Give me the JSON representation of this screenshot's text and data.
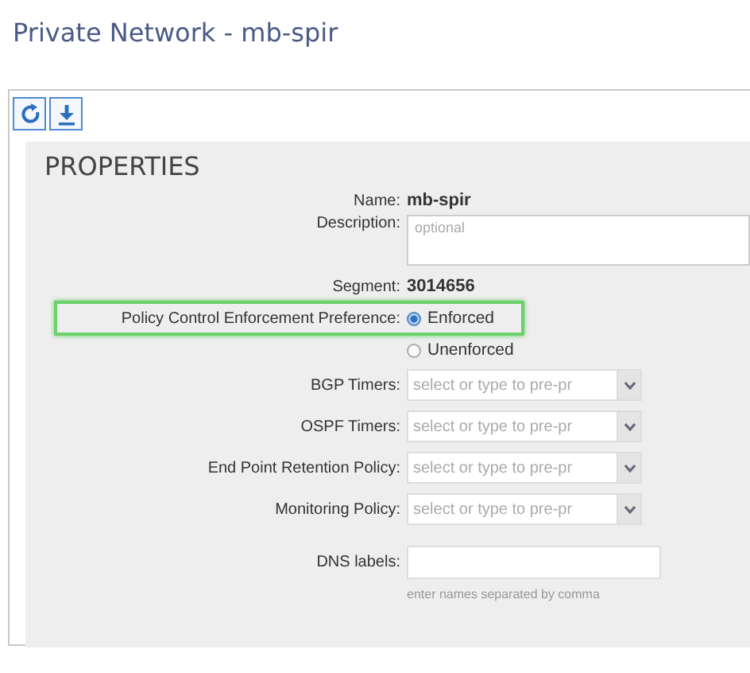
{
  "title": "Private Network - mb-spir",
  "toolbar": [
    {
      "kind": "refresh"
    },
    {
      "kind": "download"
    }
  ],
  "properties": {
    "heading": "PROPERTIES",
    "fields": [
      {
        "kind": "text",
        "label": "Name:",
        "value": "mb-spir"
      },
      {
        "kind": "textarea",
        "label": "Description:",
        "placeholder": "optional"
      },
      {
        "kind": "text",
        "label": "Segment:",
        "value": "3014656"
      },
      {
        "kind": "radio",
        "label": "Policy Control Enforcement Preference:",
        "highlighted": true,
        "options": [
          {
            "label": "Enforced",
            "selected": true
          },
          {
            "label": "Unenforced",
            "selected": false
          }
        ]
      },
      {
        "kind": "select",
        "label": "BGP Timers:",
        "placeholder": "select or type to pre-pr"
      },
      {
        "kind": "select",
        "label": "OSPF Timers:",
        "placeholder": "select or type to pre-pr"
      },
      {
        "kind": "select",
        "label": "End Point Retention Policy:",
        "placeholder": "select or type to pre-pr"
      },
      {
        "kind": "select",
        "label": "Monitoring Policy:",
        "placeholder": "select or type to pre-pr"
      },
      {
        "kind": "input",
        "label": "DNS labels:",
        "hint": "enter names separated by comma"
      }
    ]
  }
}
